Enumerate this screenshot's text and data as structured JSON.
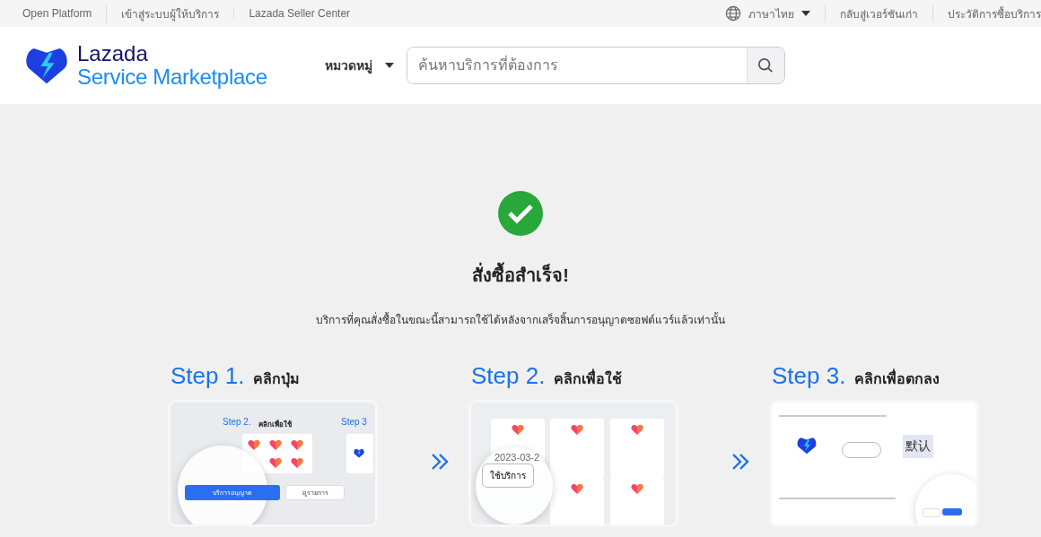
{
  "top_links": [
    "Open Platform",
    "เข้าสู่ระบบผู้ให้บริการ",
    "Lazada Seller Center"
  ],
  "language": "ภาษาไทย",
  "right_links": [
    "กลับสู่เวอร์ชันเก่า",
    "ประวัติการซื้อบริการ"
  ],
  "logo": {
    "line1": "Lazada",
    "line2": "Service Marketplace"
  },
  "category": "หมวดหมู่",
  "search": {
    "placeholder": "ค้นหาบริการที่ต้องการ"
  },
  "result": {
    "title": "สั่งซื้อสำเร็จ!",
    "message": "บริการที่คุณสั่งซื้อในขณะนี้สามารถใช้ได้หลังจากเสร็จสิ้นการอนุญาตซอฟต์แวร์แล้วเท่านั้น"
  },
  "steps": [
    {
      "kind": "authorize",
      "number": "Step 1.",
      "label": "คลิกปุ่ม",
      "preview": {
        "heading": "Step 2.",
        "heading_label": "คลิกเพื่อใช้",
        "next_heading": "Step 3",
        "primary_button": "บริการอนุญาต",
        "secondary_button": "ดูรายการ"
      }
    },
    {
      "kind": "use",
      "number": "Step 2.",
      "label": "คลิกเพื่อใช้",
      "preview": {
        "date": "2023-03-2",
        "button": "ใช้บริการ"
      }
    },
    {
      "kind": "agree",
      "number": "Step 3.",
      "label": "คลิกเพื่อตกลง",
      "preview": {
        "badge": "默认"
      }
    }
  ]
}
